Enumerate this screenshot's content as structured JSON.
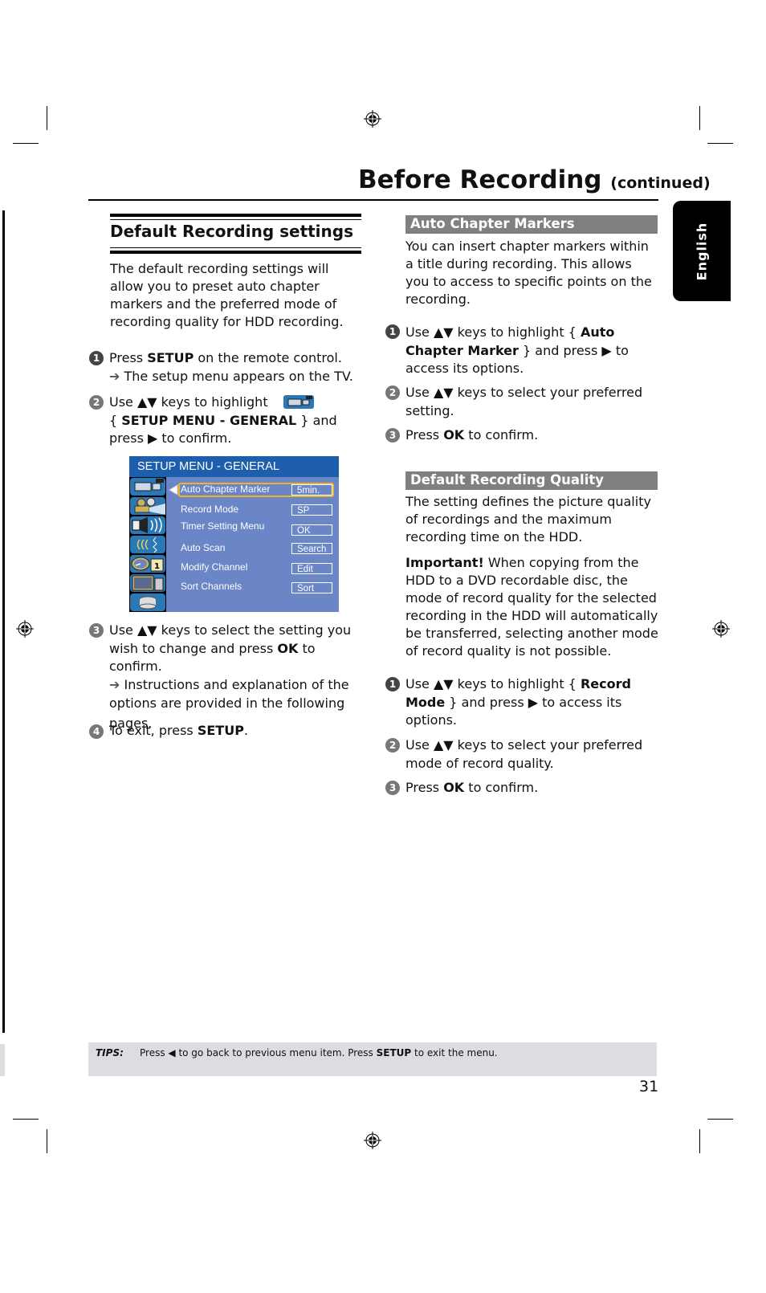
{
  "header": {
    "title": "Before Recording",
    "title_suffix": "(continued)",
    "language_tab": "English"
  },
  "left_section": {
    "title": "Default Recording settings",
    "intro": "The default recording settings will allow you to preset auto chapter markers and the preferred mode of recording quality for HDD recording.",
    "steps": [
      {
        "num": "1",
        "line1_pre": "Press ",
        "line1_bold": "SETUP",
        "line1_post": " on the remote control.",
        "result": "The setup menu appears on the TV."
      },
      {
        "num": "2",
        "line1": "Use ▲▼ keys to highlight",
        "line2_pre": "{ ",
        "line2_bold": "SETUP MENU - GENERAL",
        "line2_post": " } and",
        "line3": "press ▶ to confirm."
      },
      {
        "num": "3",
        "line1": "Use ▲▼ keys to select the setting you",
        "line2_pre": "wish to change and press ",
        "line2_bold": "OK",
        "line2_post": " to confirm.",
        "result": "Instructions and explanation of the",
        "result2": "options are provided in the following",
        "result3": "pages."
      },
      {
        "num": "4",
        "text_pre": "To exit, press ",
        "text_bold": "SETUP",
        "text_post": "."
      }
    ]
  },
  "setup_menu": {
    "title": "SETUP MENU - GENERAL",
    "icons": [
      "camcorder-icon",
      "projector-icon",
      "speaker-icon",
      "signal-icon",
      "clock-calendar-icon",
      "tv-icon",
      "disc-stack-icon"
    ],
    "rows": [
      {
        "label": "Auto Chapter Marker",
        "value": "5min.",
        "selected": true
      },
      {
        "label": "Record Mode",
        "value": "SP"
      },
      {
        "label": "Timer Setting Menu",
        "value": "OK"
      },
      {
        "label": "Auto Scan",
        "value": "Search"
      },
      {
        "label": "Modify Channel",
        "value": "Edit"
      },
      {
        "label": "Sort Channels",
        "value": "Sort"
      }
    ]
  },
  "auto_chapter": {
    "heading": "Auto Chapter Markers",
    "intro": "You can insert chapter markers within a title during recording. This allows you to access to specific points on the recording.",
    "steps": [
      {
        "num": "1",
        "l1_pre": "Use ▲▼ keys to highlight { ",
        "l1_bold": "Auto",
        "l2_bold": "Chapter Marker",
        "l2_post": " } and press ▶ to",
        "l3": "access its options."
      },
      {
        "num": "2",
        "l1": "Use ▲▼ keys to select your preferred",
        "l2": "setting."
      },
      {
        "num": "3",
        "pre": "Press ",
        "bold": "OK",
        "post": " to confirm."
      }
    ]
  },
  "recording_quality": {
    "heading": "Default Recording Quality",
    "intro": "The setting defines the picture quality of recordings and the maximum recording time on the HDD.",
    "important_label": "Important!",
    "important_text": " When copying from the HDD to a DVD recordable disc, the mode of record quality for the selected recording in the HDD will automatically be transferred, selecting another mode of record quality is not possible.",
    "steps": [
      {
        "num": "1",
        "l1_pre": "Use ▲▼ keys to highlight { ",
        "l1_bold": "Record",
        "l2_bold": "Mode",
        "l2_post": " } and press ▶ to access its",
        "l3": "options."
      },
      {
        "num": "2",
        "l1": "Use ▲▼ keys to select your preferred",
        "l2": "mode of record quality."
      },
      {
        "num": "3",
        "pre": "Press ",
        "bold": "OK",
        "post": " to confirm."
      }
    ]
  },
  "tips": {
    "label": "TIPS:",
    "pre": "Press ◀ to go back to previous menu item. Press ",
    "bold": "SETUP",
    "post": " to exit the menu."
  },
  "page_number": "31",
  "colors": {
    "menu_header": "#1e5fad",
    "menu_body": "#6a86c7",
    "selection_frame": "#f0b429",
    "section_heading_bg": "#808080",
    "tips_bg": "#dcdde0"
  }
}
